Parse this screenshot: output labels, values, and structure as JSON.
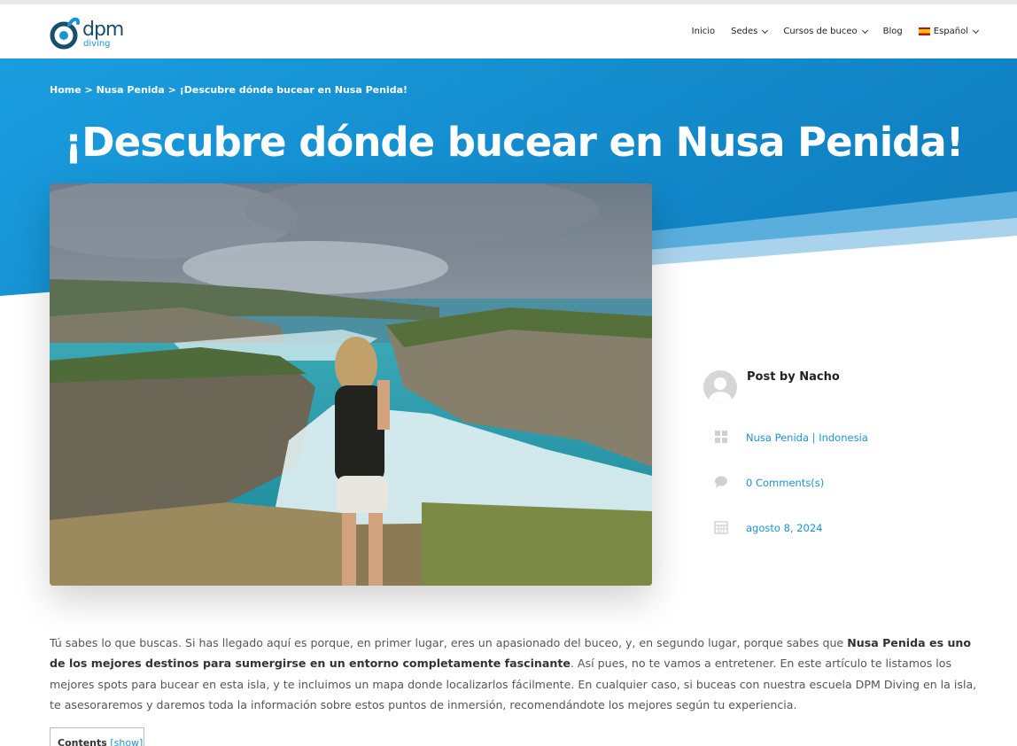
{
  "header": {
    "logo_text": "dpm",
    "logo_sub": "diving",
    "nav": {
      "inicio": "Inicio",
      "sedes": "Sedes",
      "cursos": "Cursos de buceo",
      "blog": "Blog",
      "language": "Español"
    }
  },
  "breadcrumb": {
    "home": "Home",
    "sep1": " > ",
    "category": "Nusa Penida",
    "sep2": " > ",
    "current": "¡Descubre dónde bucear en Nusa Penida!"
  },
  "post": {
    "title": "¡Descubre dónde bucear en Nusa Penida!",
    "author": "Post by Nacho",
    "categories": "Nusa Penida | Indonesia",
    "comments": "0 Comments(s)",
    "date": "agosto 8, 2024"
  },
  "content": {
    "p1_a": "Tú sabes lo que buscas. Si has llegado aquí es porque, en primer lugar, eres un apasionado del buceo, y, en segundo lugar, porque sabes que ",
    "p1_bold": "Nusa Penida es uno de los mejores destinos para sumergirse en un entorno completamente fascinante",
    "p1_b": ". Así pues, no te vamos a entretener. En este artículo te listamos los mejores spots para bucear en esta isla, y te incluimos un mapa donde localizarlos fácilmente. En cualquier caso, si buceas con nuestra escuela DPM Diving en la isla, te asesoraremos y daremos toda la información sobre estos puntos de inmersión, recomendándote los mejores según tu experiencia."
  },
  "toc": {
    "title": "Contents",
    "toggle": "[show]"
  },
  "colors": {
    "brand_blue": "#1c93d6",
    "hero_blue": "#1590d4",
    "logo_dark": "#1a4e6e"
  }
}
